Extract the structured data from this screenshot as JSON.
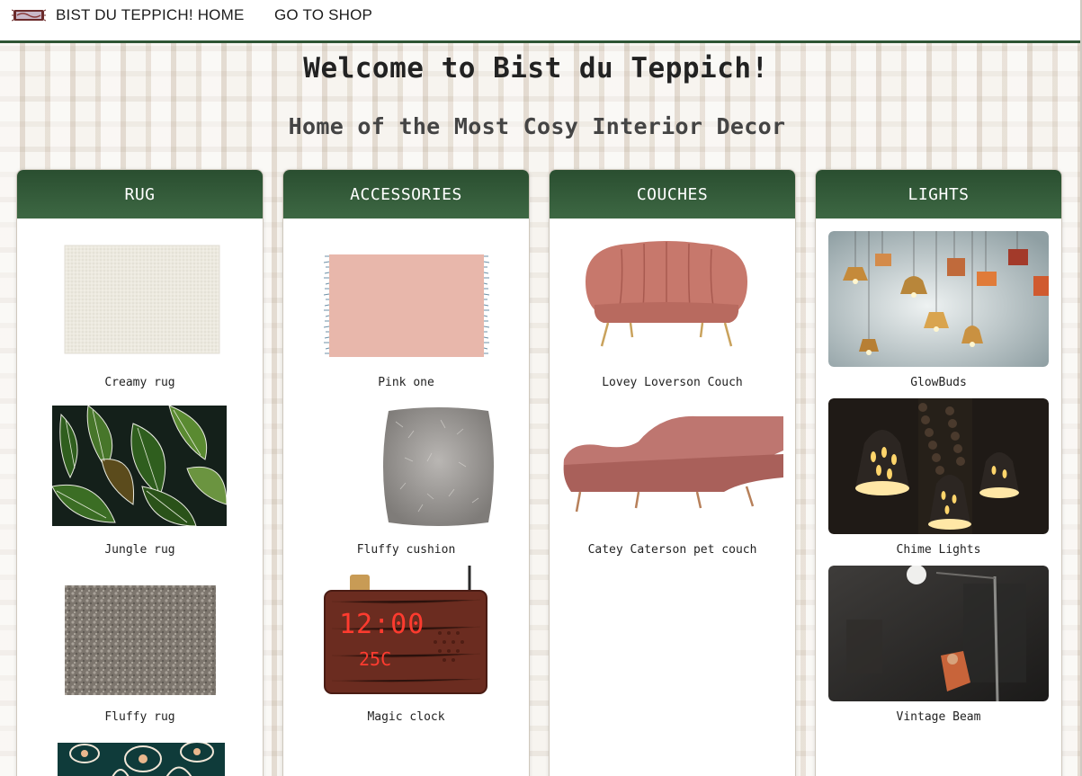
{
  "nav": {
    "logo_icon": "rug-logo-icon",
    "home_label": "BIST DU TEPPICH! HOME",
    "shop_label": "GO TO SHOP"
  },
  "hero": {
    "title": "Welcome to Bist du Teppich!",
    "subtitle": "Home of the Most Cosy Interior Decor"
  },
  "colors": {
    "header_green": "#2e5434",
    "page_background": "#efe9e1"
  },
  "columns": [
    {
      "header": "RUG",
      "items": [
        "Creamy rug",
        "Jungle rug",
        "Fluffy rug",
        ""
      ]
    },
    {
      "header": "ACCESSORIES",
      "items": [
        "Pink one",
        "Fluffy cushion",
        "Magic clock"
      ]
    },
    {
      "header": "COUCHES",
      "items": [
        "Lovey Loverson Couch",
        "Catey Caterson pet couch"
      ]
    },
    {
      "header": "LIGHTS",
      "items": [
        "GlowBuds",
        "Chime Lights",
        "Vintage Beam"
      ]
    }
  ],
  "clock": {
    "time": "12:00",
    "temp": "25C"
  }
}
